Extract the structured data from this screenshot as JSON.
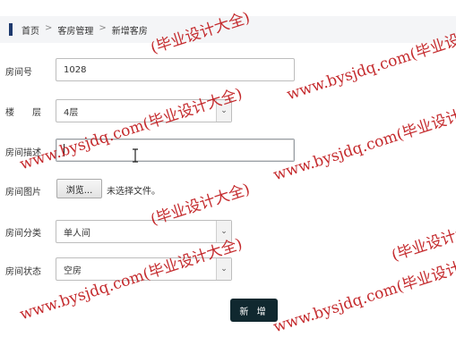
{
  "breadcrumb": {
    "items": [
      "首页",
      "客房管理",
      "新增客房"
    ],
    "separator": ">"
  },
  "form": {
    "room_number": {
      "label": "房间号",
      "value": "1028"
    },
    "floor": {
      "label": "楼　　层",
      "value": "4层"
    },
    "description": {
      "label": "房间描述",
      "value": ""
    },
    "image": {
      "label": "房间图片",
      "button": "浏览...",
      "status": "未选择文件。"
    },
    "category": {
      "label": "房间分类",
      "value": "单人间"
    },
    "status": {
      "label": "房间状态",
      "value": "空房"
    },
    "submit_label": "新 增"
  },
  "watermark": {
    "url_text": "www.bysjdq.com",
    "paren_text": "(毕业设计大全)",
    "combo_text": "www.bysjdq.com(毕业设计大全)",
    "color": "#c0191c"
  }
}
